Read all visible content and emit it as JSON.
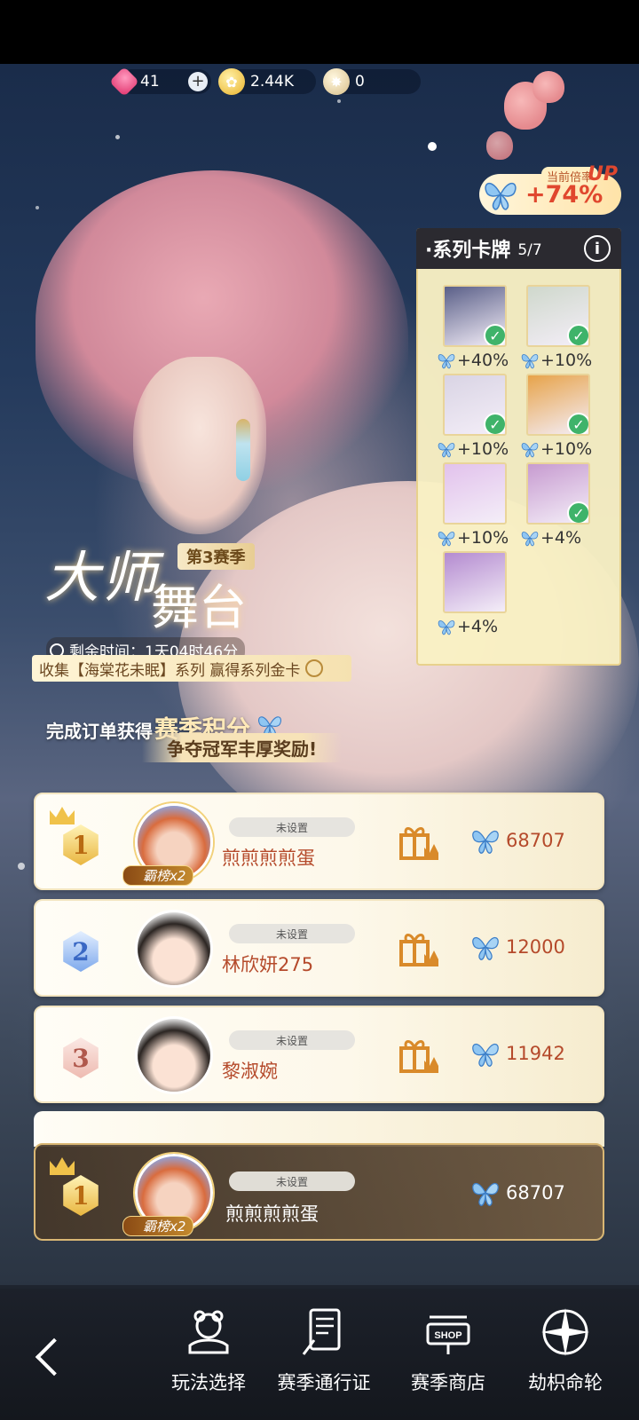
{
  "currencies": {
    "gems": "41",
    "gold": "2.44K",
    "stars": "0"
  },
  "rate": {
    "label": "当前倍率",
    "up": "UP",
    "value": "+74%"
  },
  "series": {
    "title": "·系列卡牌",
    "count": "5/7",
    "info": "i",
    "cards": [
      {
        "bonus": "+40%",
        "owned": true,
        "color": "#5a5f88"
      },
      {
        "bonus": "+10%",
        "owned": true,
        "color": "#cfd8cc"
      },
      {
        "bonus": "+10%",
        "owned": true,
        "color": "#d9d4e4"
      },
      {
        "bonus": "+10%",
        "owned": true,
        "color": "#e7a34a"
      },
      {
        "bonus": "+10%",
        "owned": false,
        "color": "#e2c2ec"
      },
      {
        "bonus": "+4%",
        "owned": true,
        "color": "#c79bd0"
      },
      {
        "bonus": "+4%",
        "owned": false,
        "color": "#b48bd0"
      }
    ]
  },
  "season": {
    "title_1": "大师",
    "title_2": "舞台",
    "tag": "第3赛季",
    "timer": "剩余时间：1天04时46分",
    "collect": "收集【海棠花未眠】系列 赢得系列金卡",
    "mission_prefix": "完成订单获得",
    "mission_big": "赛季积分",
    "mission_sub": "争夺冠军丰厚奖励!"
  },
  "ranking": [
    {
      "rank": "1",
      "unset": "未设置",
      "name": "煎煎煎煎蛋",
      "score": "68707",
      "tag": "霸榜x2"
    },
    {
      "rank": "2",
      "unset": "未设置",
      "name": "林欣妍275",
      "score": "12000"
    },
    {
      "rank": "3",
      "unset": "未设置",
      "name": "黎淑婉",
      "score": "11942"
    }
  ],
  "my_rank": {
    "rank": "1",
    "unset": "未设置",
    "name": "煎煎煎煎蛋",
    "score": "68707",
    "tag": "霸榜x2"
  },
  "nav": {
    "play": "玩法选择",
    "pass": "赛季通行证",
    "shop": "赛季商店",
    "shop_sign": "SHOP",
    "wheel": "劫枳命轮"
  }
}
